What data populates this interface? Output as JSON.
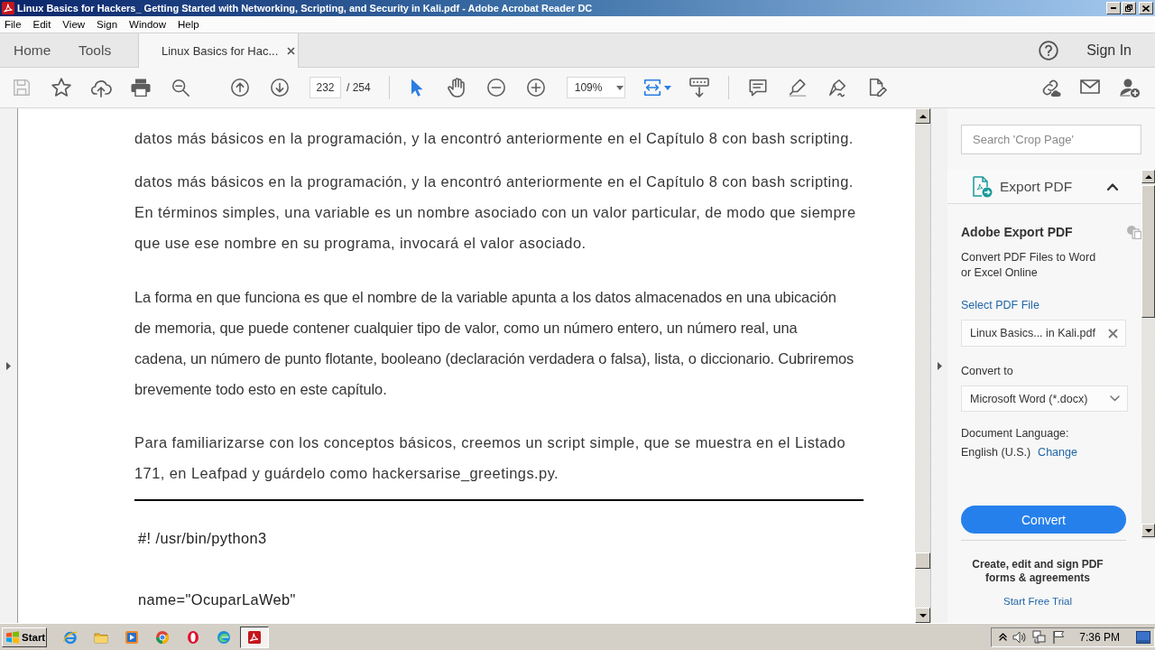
{
  "window": {
    "title": "Linux Basics for Hackers_ Getting Started with Networking, Scripting, and Security in Kali.pdf - Adobe Acrobat Reader DC"
  },
  "menu": [
    "File",
    "Edit",
    "View",
    "Sign",
    "Window",
    "Help"
  ],
  "tabs": [
    {
      "label": "Home",
      "selected": false,
      "closable": false
    },
    {
      "label": "Tools",
      "selected": false,
      "closable": false
    },
    {
      "label": "Linux Basics for Hac...",
      "selected": true,
      "closable": true
    }
  ],
  "account": {
    "sign_in": "Sign In"
  },
  "toolbar": {
    "save": {
      "disabled": true
    },
    "select_tool": {
      "selected": true
    },
    "page_number": "232",
    "page_count": "/ 254",
    "zoom": "109%"
  },
  "document": {
    "paragraphs": [
      {
        "lines": [
          "datos más básicos en la programación, y la encontró anteriormente en el Capítulo 8 con bash scripting."
        ]
      },
      {
        "lines": [
          "datos más básicos en la programación, y la encontró anteriormente en el Capítulo 8 con bash scripting.",
          "En términos simples, una variable es un nombre asociado con un valor particular, de modo que siempre",
          "que use ese nombre en su programa, invocará el valor asociado."
        ]
      },
      {
        "lines": [
          "La forma en que funciona es que el nombre de la variable apunta a los datos almacenados en una ubicación",
          "de memoria, que puede contener cualquier tipo de valor, como un número entero, un número real, una",
          "cadena, un número de punto flotante, booleano (declaración verdadera o falsa), lista, o diccionario. Cubriremos",
          "brevemente todo esto en este capítulo."
        ]
      },
      {
        "lines": [
          "Para familiarizarse con los conceptos básicos, creemos un script simple, que se muestra en el Listado",
          "171, en Leafpad y guárdelo como hackersarise_greetings.py."
        ]
      }
    ],
    "code_lines": [
      "#! /usr/bin/python3",
      "name=\"OcuparLaWeb\""
    ]
  },
  "panel": {
    "search": {
      "placeholder": "Search 'Crop Page'"
    },
    "section": {
      "title": "Export PDF",
      "expanded": true
    },
    "heading": "Adobe Export PDF",
    "description": [
      "Convert PDF Files to Word",
      "or Excel Online"
    ],
    "select_link": "Select PDF File",
    "file": {
      "value": "Linux Basics... in Kali.pdf"
    },
    "convert_label": "Convert to",
    "format": {
      "value": "Microsoft Word (*.docx)"
    },
    "language_label": "Document Language:",
    "language": "English (U.S.)",
    "change_link": "Change",
    "button": "Convert",
    "promo": [
      "Create, edit and sign PDF",
      "forms & agreements"
    ],
    "trial_link": "Start Free Trial"
  },
  "taskbar": {
    "start": "Start",
    "apps": [
      {
        "selected": false
      },
      {
        "selected": false
      },
      {
        "selected": false
      },
      {
        "selected": false
      },
      {
        "selected": false
      },
      {
        "selected": false
      },
      {
        "selected": true
      }
    ],
    "clock": "7:36 PM"
  }
}
